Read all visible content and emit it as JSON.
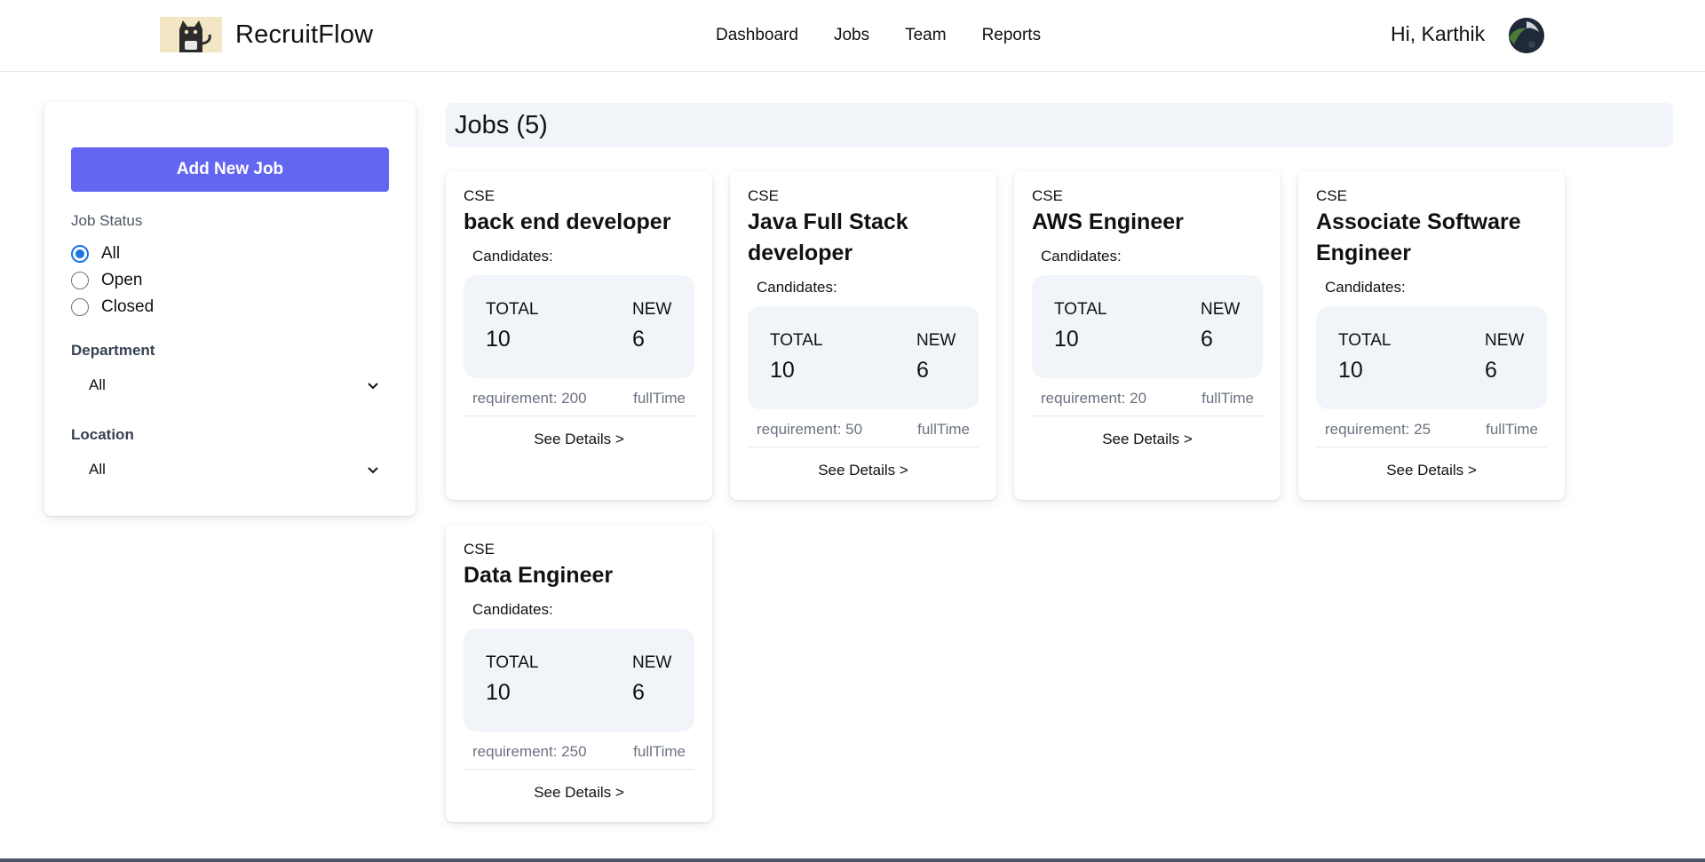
{
  "header": {
    "brand": "RecruitFlow",
    "nav": [
      "Dashboard",
      "Jobs",
      "Team",
      "Reports"
    ],
    "greeting": "Hi, Karthik"
  },
  "sidebar": {
    "add_button": "Add New Job",
    "job_status": {
      "label": "Job Status",
      "options": [
        "All",
        "Open",
        "Closed"
      ],
      "selected": "All"
    },
    "department": {
      "label": "Department",
      "value": "All"
    },
    "location": {
      "label": "Location",
      "value": "All"
    }
  },
  "jobs": {
    "heading": "Jobs (5)",
    "candidates_label": "Candidates:",
    "total_label": "TOTAL",
    "new_label": "NEW",
    "see_details": "See Details >",
    "items": [
      {
        "dept": "CSE",
        "title": "back end developer",
        "total": "10",
        "new": "6",
        "requirement": "requirement: 200",
        "type": "fullTime"
      },
      {
        "dept": "CSE",
        "title": "Java Full Stack developer",
        "total": "10",
        "new": "6",
        "requirement": "requirement: 50",
        "type": "fullTime"
      },
      {
        "dept": "CSE",
        "title": "AWS Engineer",
        "total": "10",
        "new": "6",
        "requirement": "requirement: 20",
        "type": "fullTime"
      },
      {
        "dept": "CSE",
        "title": "Associate Software Engineer",
        "total": "10",
        "new": "6",
        "requirement": "requirement: 25",
        "type": "fullTime"
      },
      {
        "dept": "CSE",
        "title": "Data Engineer",
        "total": "10",
        "new": "6",
        "requirement": "requirement: 250",
        "type": "fullTime"
      }
    ]
  },
  "colors": {
    "accent": "#6366f1",
    "panel_bg": "#f1f4f8",
    "radio_checked": "#1a73e8"
  }
}
